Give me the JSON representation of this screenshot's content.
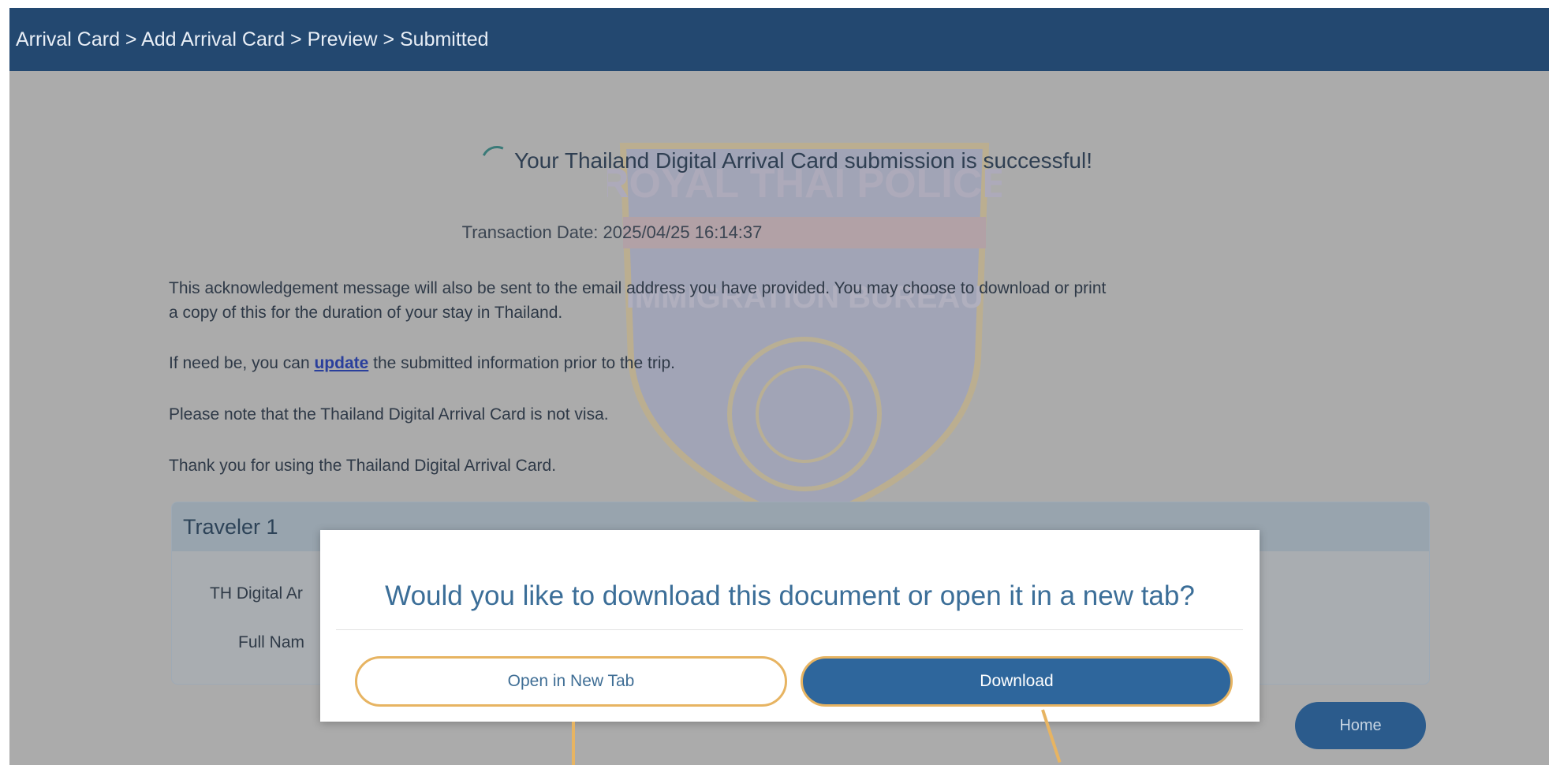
{
  "header": {
    "breadcrumb": "Arrival Card > Add Arrival Card > Preview > Submitted"
  },
  "main": {
    "headline": "Your Thailand Digital Arrival Card submission is successful!",
    "transaction_date": "Transaction Date: 2025/04/25 16:14:37",
    "paragraph_ack_line1": "This acknowledgement message will also be sent to the email address you have provided. You may choose to download or print",
    "paragraph_ack_line2": "a copy of this for the duration of your stay in Thailand.",
    "update_prefix": "If need be, you can ",
    "update_link": "update",
    "update_suffix": " the submitted information prior to the trip.",
    "visa_note": "Please note that the Thailand Digital Arrival Card is not visa.",
    "thanks": "Thank you for using the Thailand Digital Arrival Card.",
    "watermark": {
      "top_text": "ROYAL THAI POLICE",
      "mid_text": "IMMIGRATION BUREAU"
    }
  },
  "traveler": {
    "title": "Traveler 1",
    "row1_label": "TH Digital Ar",
    "row2_label": "Full Nam"
  },
  "home_button": "Home",
  "modal": {
    "title": "Would you like to download this document or open it in a new tab?",
    "open_label": "Open in New Tab",
    "download_label": "Download"
  },
  "colors": {
    "header_bg": "#234870",
    "primary_button": "#2e669c",
    "highlight_outline": "#e7b462",
    "overlay": "#ababab"
  }
}
